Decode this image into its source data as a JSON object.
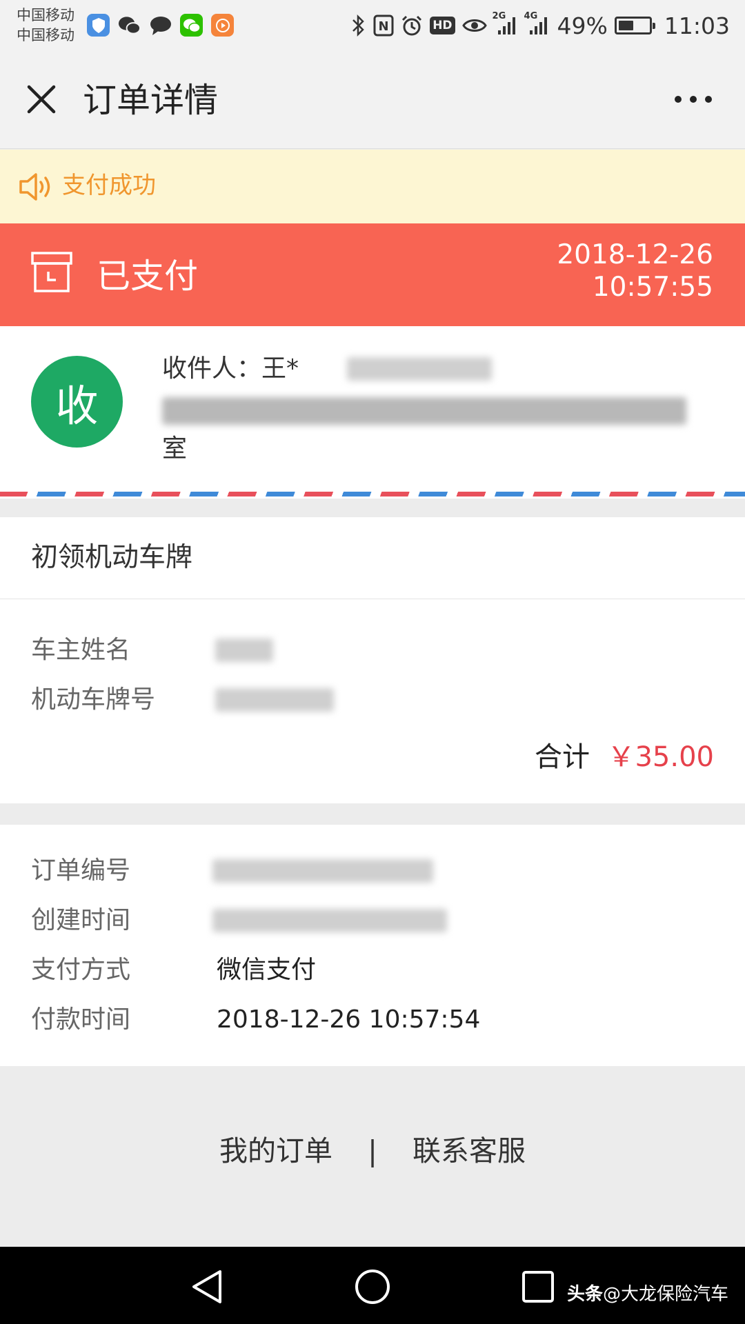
{
  "status_bar": {
    "carrier_1": "中国移动",
    "carrier_2": "中国移动",
    "net_1": "2G",
    "net_2": "4G",
    "battery_percent": "49%",
    "battery_level": 0.49,
    "time": "11:03",
    "hd_label": "HD",
    "nfc_label": "N"
  },
  "title_bar": {
    "title": "订单详情"
  },
  "notice": {
    "text": "支付成功"
  },
  "order_status": {
    "label": "已支付",
    "date": "2018-12-26",
    "time": "10:57:55"
  },
  "address": {
    "avatar_label": "收",
    "recipient": "收件人：王*",
    "address_tail": "室"
  },
  "product": {
    "name": "初领机动车牌",
    "owner_label": "车主姓名",
    "plate_label": "机动车牌号",
    "total_label": "合计",
    "total_value": "￥35.00"
  },
  "order_info": {
    "number_label": "订单编号",
    "created_label": "创建时间",
    "pay_method_label": "支付方式",
    "pay_method_value": "微信支付",
    "pay_time_label": "付款时间",
    "pay_time_value": "2018-12-26 10:57:54"
  },
  "footer": {
    "my_orders": "我的订单",
    "separator": "|",
    "contact": "联系客服"
  },
  "watermark": {
    "brand": "头条",
    "handle": "@大龙保险汽车"
  },
  "colors": {
    "status_band": "#f86453",
    "notice_bg": "#fdf6d3",
    "notice_text": "#f0962e",
    "avatar": "#1ea964",
    "price": "#e6414b"
  }
}
